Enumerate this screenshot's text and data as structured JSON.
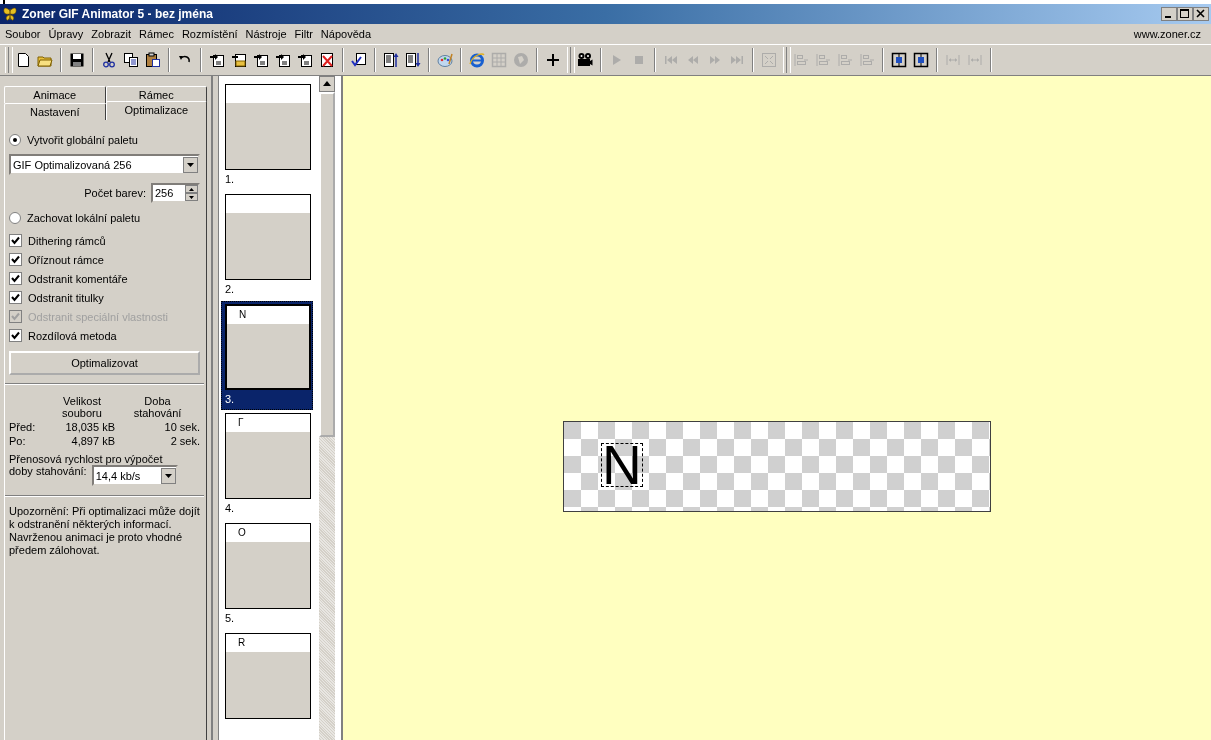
{
  "window": {
    "title": "Zoner GIF Animator 5 - bez jména"
  },
  "menu": {
    "items": [
      "Soubor",
      "Úpravy",
      "Zobrazit",
      "Rámec",
      "Rozmístění",
      "Nástroje",
      "Filtr",
      "Nápověda"
    ],
    "link": "www.zoner.cz"
  },
  "toolbar": [
    {
      "kind": "new",
      "disabled": false
    },
    {
      "kind": "open",
      "disabled": false
    },
    {
      "kind": "sep"
    },
    {
      "kind": "save",
      "disabled": false
    },
    {
      "kind": "sep"
    },
    {
      "kind": "cut",
      "disabled": false
    },
    {
      "kind": "copy",
      "disabled": false
    },
    {
      "kind": "paste",
      "disabled": false
    },
    {
      "kind": "sep"
    },
    {
      "kind": "undo",
      "disabled": false
    },
    {
      "kind": "sep"
    },
    {
      "kind": "frame",
      "disabled": false
    },
    {
      "kind": "frame-open",
      "disabled": false
    },
    {
      "kind": "frame",
      "disabled": false
    },
    {
      "kind": "frame",
      "disabled": false
    },
    {
      "kind": "frame",
      "disabled": false
    },
    {
      "kind": "frame-delete",
      "disabled": false
    },
    {
      "kind": "sep"
    },
    {
      "kind": "check",
      "disabled": false
    },
    {
      "kind": "sep"
    },
    {
      "kind": "list-up",
      "disabled": false
    },
    {
      "kind": "list-down",
      "disabled": false
    },
    {
      "kind": "sep"
    },
    {
      "kind": "palette",
      "disabled": false
    },
    {
      "kind": "sep"
    },
    {
      "kind": "browser",
      "disabled": false
    },
    {
      "kind": "grid",
      "disabled": true
    },
    {
      "kind": "disc",
      "disabled": true
    },
    {
      "kind": "sep"
    },
    {
      "kind": "plus",
      "disabled": false
    },
    {
      "kind": "sep2"
    },
    {
      "kind": "film",
      "disabled": false
    },
    {
      "kind": "sep"
    },
    {
      "kind": "play",
      "disabled": true
    },
    {
      "kind": "stop",
      "disabled": true
    },
    {
      "kind": "sep"
    },
    {
      "kind": "first",
      "disabled": true
    },
    {
      "kind": "prev",
      "disabled": true
    },
    {
      "kind": "next",
      "disabled": true
    },
    {
      "kind": "last",
      "disabled": true
    },
    {
      "kind": "sep"
    },
    {
      "kind": "fit",
      "disabled": true
    },
    {
      "kind": "sep2"
    },
    {
      "kind": "align",
      "disabled": true
    },
    {
      "kind": "align",
      "disabled": true
    },
    {
      "kind": "align",
      "disabled": true
    },
    {
      "kind": "align",
      "disabled": true
    },
    {
      "kind": "sep"
    },
    {
      "kind": "center",
      "disabled": false
    },
    {
      "kind": "center",
      "disabled": false
    },
    {
      "kind": "sep"
    },
    {
      "kind": "space",
      "disabled": true
    },
    {
      "kind": "space",
      "disabled": true
    },
    {
      "kind": "sep"
    }
  ],
  "panel": {
    "tab_rows": [
      [
        {
          "label": "Animace",
          "selected": false
        },
        {
          "label": "Rámec",
          "selected": false
        }
      ],
      [
        {
          "label": "Nastavení",
          "selected": false
        },
        {
          "label": "Optimalizace",
          "selected": true
        }
      ]
    ],
    "global_palette": {
      "label": "Vytvořit globální paletu",
      "selected": true
    },
    "palette_select": {
      "value": "GIF Optimalizovaná 256"
    },
    "color_count": {
      "label": "Počet barev:",
      "value": "256"
    },
    "local_palette": {
      "label": "Zachovat lokální paletu",
      "selected": false
    },
    "options": [
      {
        "label": "Dithering rámců",
        "checked": true,
        "disabled": false
      },
      {
        "label": "Oříznout rámce",
        "checked": true,
        "disabled": false
      },
      {
        "label": "Odstranit komentáře",
        "checked": true,
        "disabled": false
      },
      {
        "label": "Odstranit titulky",
        "checked": true,
        "disabled": false
      },
      {
        "label": "Odstranit speciální vlastnosti",
        "checked": true,
        "disabled": true
      },
      {
        "label": "Rozdílová metoda",
        "checked": true,
        "disabled": false
      }
    ],
    "optimize_button": "Optimalizovat",
    "stats": {
      "columns": [
        "Velikost souboru",
        "Doba stahování"
      ],
      "rows": [
        {
          "label": "Před:",
          "size": "18,035 kB",
          "time": "10 sek."
        },
        {
          "label": "Po:",
          "size": "4,897 kB",
          "time": "2 sek."
        }
      ]
    },
    "speed_label": [
      "Přenosová rychlost pro výpočet",
      "doby stahování:"
    ],
    "speed_select": {
      "value": "14,4 kb/s"
    },
    "note": "Upozornění: Při optimalizaci může dojít k odstranění některých informací. Navrženou animaci je proto vhodné předem zálohovat."
  },
  "frames": [
    {
      "label": "1.",
      "selected": false
    },
    {
      "label": "2.",
      "selected": false
    },
    {
      "label": "3.",
      "text": "N",
      "selected": true
    },
    {
      "label": "4.",
      "text": "Γ",
      "selected": false
    },
    {
      "label": "5.",
      "text": "O",
      "selected": false
    },
    {
      "text": "R",
      "selected": false
    }
  ],
  "canvas": {
    "frame_text": "N"
  }
}
